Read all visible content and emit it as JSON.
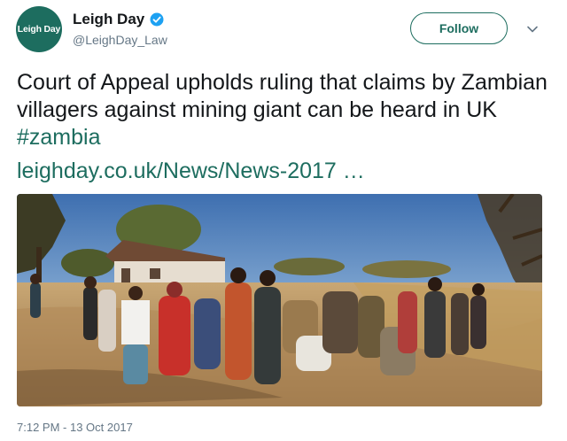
{
  "account": {
    "avatar_text": "Leigh Day",
    "display_name": "Leigh Day",
    "handle": "@LeighDay_Law",
    "verified": true
  },
  "actions": {
    "follow_label": "Follow",
    "menu_icon": "chevron-down-icon"
  },
  "tweet": {
    "text": "Court of Appeal upholds ruling that claims by Zambian villagers against mining giant can be heard in UK ",
    "hashtag": "#zambia",
    "link": "leighday.co.uk/News/News-2017",
    "link_ellipsis": " …"
  },
  "media": {
    "type": "photo"
  },
  "meta": {
    "timestamp": "7:12 PM - 13 Oct 2017"
  },
  "colors": {
    "accent": "#1d6d5f",
    "secondary_text": "#657786",
    "verified": "#1da1f2"
  }
}
